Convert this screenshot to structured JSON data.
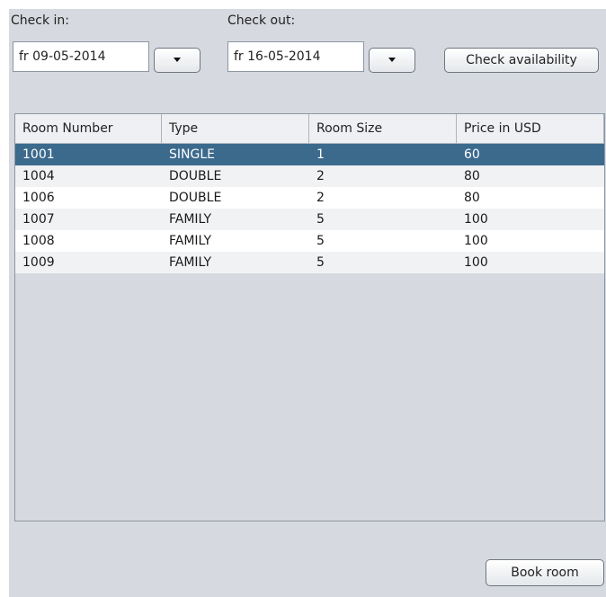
{
  "check_in": {
    "label": "Check in:",
    "value": "fr 09-05-2014"
  },
  "check_out": {
    "label": "Check out:",
    "value": "fr 16-05-2014"
  },
  "check_availability_label": "Check availability",
  "book_room_label": "Book room",
  "table": {
    "headers": [
      "Room Number",
      "Type",
      "Room Size",
      "Price in USD"
    ],
    "rows": [
      [
        "1001",
        "SINGLE",
        "1",
        "60"
      ],
      [
        "1004",
        "DOUBLE",
        "2",
        "80"
      ],
      [
        "1006",
        "DOUBLE",
        "2",
        "80"
      ],
      [
        "1007",
        "FAMILY",
        "5",
        "100"
      ],
      [
        "1008",
        "FAMILY",
        "5",
        "100"
      ],
      [
        "1009",
        "FAMILY",
        "5",
        "100"
      ]
    ],
    "selected_row": 0
  },
  "colors": {
    "panel": "#d6d9df",
    "selection": "#3b6a8d",
    "header": "#eef0f3"
  }
}
